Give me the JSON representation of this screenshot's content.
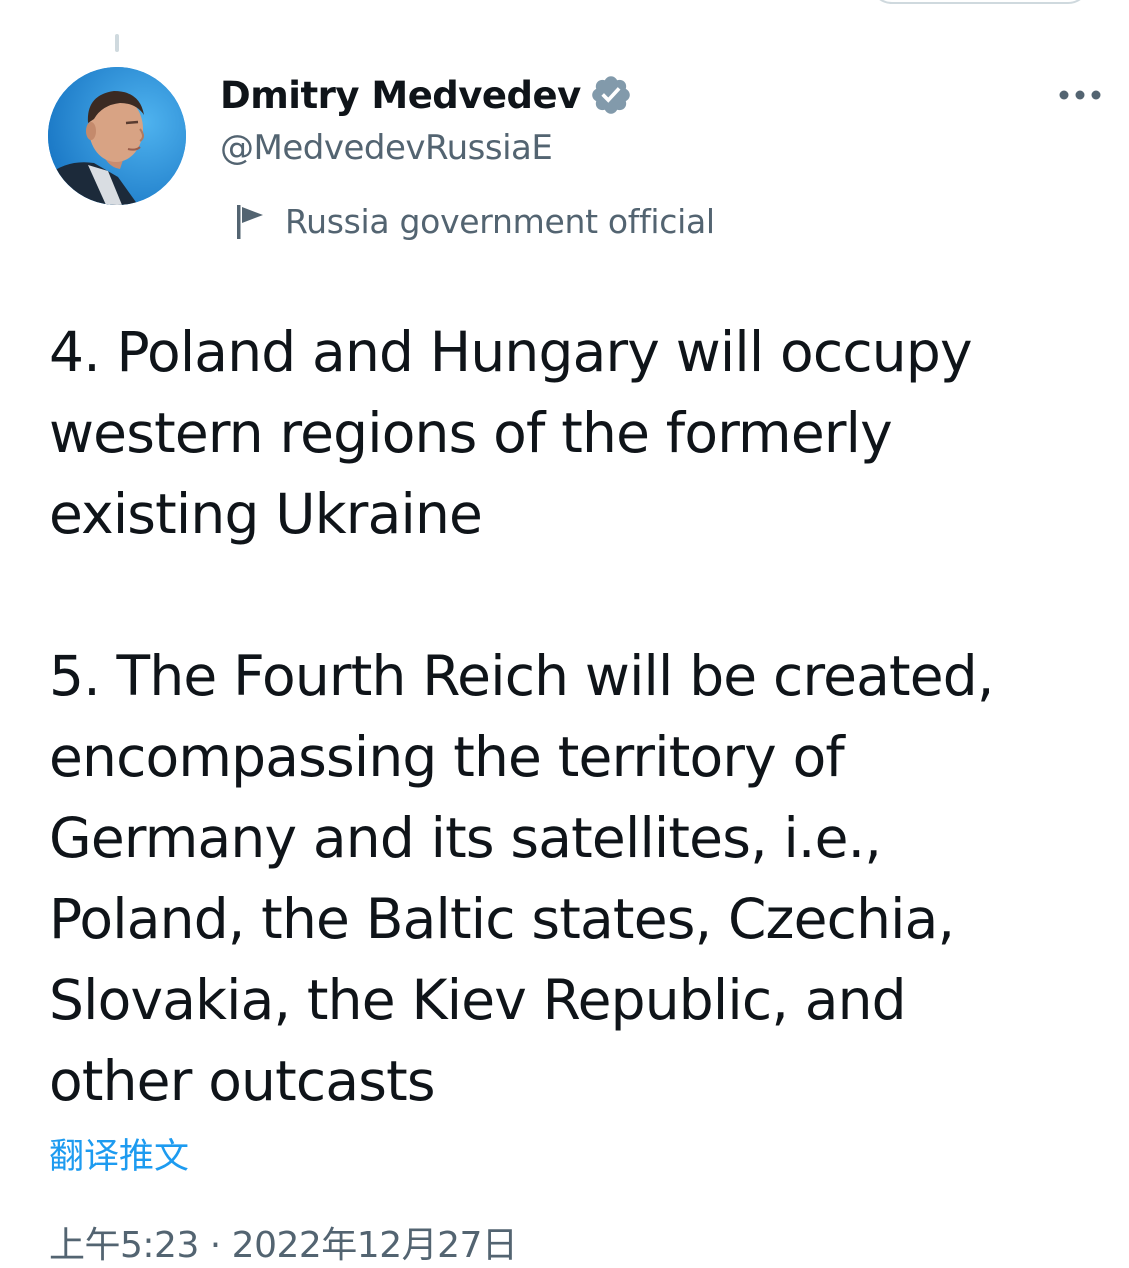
{
  "tweet": {
    "author": {
      "display_name": "Dmitry Medvedev",
      "handle": "@MedvedevRussiaE",
      "verified": true,
      "account_label": "Russia government official"
    },
    "lines": [
      "4. Poland and Hungary will occupy",
      "western regions of the formerly",
      "existing Ukraine",
      "",
      "5. The Fourth Reich will be created,",
      "encompassing the territory of",
      "Germany and its satellites, i.e.,",
      "Poland, the Baltic states, Czechia,",
      "Slovakia, the Kiev Republic, and",
      "other outcasts"
    ],
    "translate_label": "翻译推文",
    "timestamp": "上午5:23 · 2022年12月27日"
  },
  "icons": {
    "verified": "verified-badge-icon",
    "label": "flag-icon",
    "more": "more-horizontal-icon"
  },
  "colors": {
    "text_primary": "#0f1419",
    "text_secondary": "#536471",
    "link": "#1d9bf0",
    "badge": "#829aab"
  }
}
